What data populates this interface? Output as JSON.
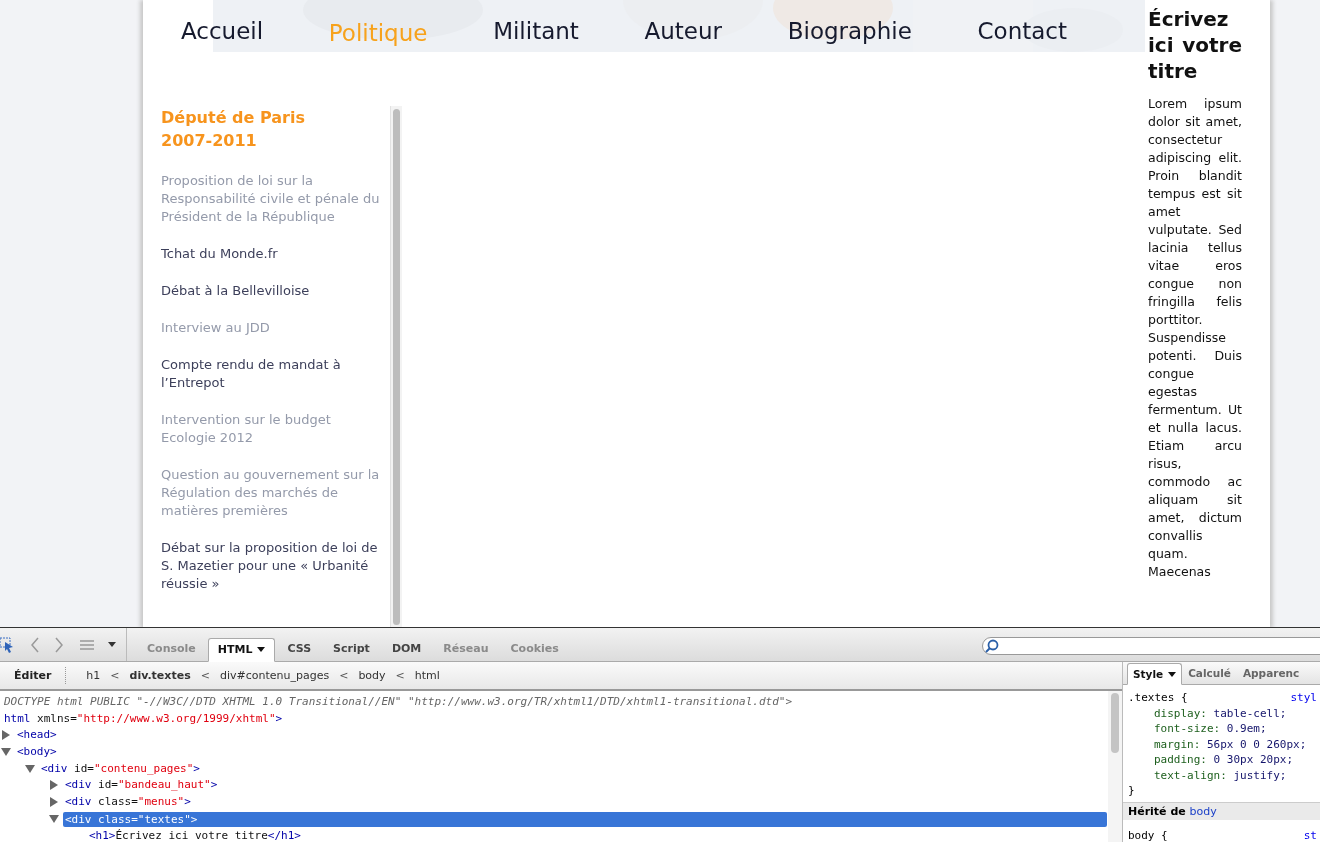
{
  "nav": [
    {
      "label": "Accueil",
      "selected": false
    },
    {
      "label": "Politique",
      "selected": true
    },
    {
      "label": "Militant",
      "selected": false
    },
    {
      "label": "Auteur",
      "selected": false
    },
    {
      "label": "Biographie",
      "selected": false
    },
    {
      "label": "Contact",
      "selected": false
    }
  ],
  "sidebar": {
    "title": "Député de Paris 2007-2011",
    "items": [
      {
        "label": "Proposition de loi sur la Responsabilité civile et pénale du Président de la République",
        "visited": true
      },
      {
        "label": "Tchat du Monde.fr",
        "visited": false
      },
      {
        "label": "Débat à la Bellevilloise",
        "visited": false
      },
      {
        "label": "Interview au JDD",
        "visited": true
      },
      {
        "label": "Compte rendu de mandat à l’Entrepot",
        "visited": false
      },
      {
        "label": "Intervention sur le budget Ecologie 2012",
        "visited": true
      },
      {
        "label": "Question au gouvernement sur la Régulation des marchés de matières premières",
        "visited": true
      },
      {
        "label": "Débat sur la proposition de loi de S. Mazetier pour une « Urbanité réussie »",
        "visited": false
      }
    ]
  },
  "article": {
    "title": "Écrivez ici votre titre",
    "body": "Lorem ipsum dolor sit amet, consectetur adipiscing elit. Proin blandit tempus est sit amet vulputate. Sed lacinia tellus vitae eros congue non fringilla felis porttitor. Suspendisse potenti. Duis congue egestas fermentum. Ut et nulla lacus. Etiam arcu risus, commodo ac aliquam sit amet, dictum convallis quam. Maecenas"
  },
  "devtools": {
    "tabs": [
      {
        "label": "Console",
        "selected": false,
        "disabled": true
      },
      {
        "label": "HTML",
        "selected": true,
        "disabled": false
      },
      {
        "label": "CSS",
        "selected": false,
        "disabled": false
      },
      {
        "label": "Script",
        "selected": false,
        "disabled": false
      },
      {
        "label": "DOM",
        "selected": false,
        "disabled": false
      },
      {
        "label": "Réseau",
        "selected": false,
        "disabled": true
      },
      {
        "label": "Cookies",
        "selected": false,
        "disabled": true
      }
    ],
    "breadcrumb": {
      "edit_button": "Éditer",
      "separator": "<",
      "items": [
        {
          "label": "h1",
          "selected": false
        },
        {
          "label": "div.textes",
          "selected": true
        },
        {
          "label": "div#contenu_pages",
          "selected": false
        },
        {
          "label": "body",
          "selected": false
        },
        {
          "label": "html",
          "selected": false
        }
      ]
    },
    "tree": [
      {
        "parts": [
          {
            "kind": "doctype",
            "text": "DOCTYPE html PUBLIC \"-//W3C//DTD XHTML 1.0 Transitional//EN\" \"http://www.w3.org/TR/xhtml1/DTD/xhtml1-transitional.dtd\">"
          }
        ]
      },
      {
        "parts": [
          {
            "kind": "tag",
            "text": "html"
          },
          {
            "kind": "attr",
            "text": " xmlns="
          },
          {
            "kind": "value",
            "text": "\"http://www.w3.org/1999/xhtml\""
          },
          {
            "kind": "tag",
            "text": ">"
          }
        ],
        "selected": false,
        "children": [
          {
            "parts": [
              {
                "kind": "tag",
                "text": "<head>"
              }
            ],
            "expanded": false,
            "selected": false
          },
          {
            "parts": [
              {
                "kind": "tag",
                "text": "<body>"
              }
            ],
            "expanded": true,
            "selected": false,
            "children": [
              {
                "parts": [
                  {
                    "kind": "tag",
                    "text": "<div"
                  },
                  {
                    "kind": "attr",
                    "text": " id="
                  },
                  {
                    "kind": "value",
                    "text": "\"contenu_pages\""
                  },
                  {
                    "kind": "tag",
                    "text": ">"
                  }
                ],
                "expanded": true,
                "selected": false,
                "children": [
                  {
                    "parts": [
                      {
                        "kind": "tag",
                        "text": "<div"
                      },
                      {
                        "kind": "attr",
                        "text": " id="
                      },
                      {
                        "kind": "value",
                        "text": "\"bandeau_haut\""
                      },
                      {
                        "kind": "tag",
                        "text": ">"
                      }
                    ],
                    "expanded": false,
                    "selected": false
                  },
                  {
                    "parts": [
                      {
                        "kind": "tag",
                        "text": "<div"
                      },
                      {
                        "kind": "attr",
                        "text": " class="
                      },
                      {
                        "kind": "value",
                        "text": "\"menus\""
                      },
                      {
                        "kind": "tag",
                        "text": ">"
                      }
                    ],
                    "expanded": false,
                    "selected": false
                  },
                  {
                    "parts": [
                      {
                        "kind": "tag",
                        "text": "<div"
                      },
                      {
                        "kind": "attr",
                        "text": " class="
                      },
                      {
                        "kind": "value",
                        "text": "\"textes\""
                      },
                      {
                        "kind": "tag",
                        "text": ">"
                      }
                    ],
                    "expanded": true,
                    "selected": true,
                    "children": [
                      {
                        "parts": [
                          {
                            "kind": "tag",
                            "text": "<h1>"
                          },
                          {
                            "kind": "text",
                            "text": "Écrivez ici votre titre"
                          },
                          {
                            "kind": "tag",
                            "text": "</h1>"
                          }
                        ],
                        "selected": false
                      }
                    ]
                  }
                ]
              }
            ]
          }
        ]
      }
    ],
    "side_tabs": [
      {
        "label": "Style",
        "selected": true
      },
      {
        "label": "Calculé",
        "selected": false
      },
      {
        "label": "Apparenc",
        "selected": false
      }
    ],
    "rules": [
      {
        "selector": ".textes {",
        "source": "styl",
        "declarations": [
          {
            "property": "display:",
            "value": "table-cell;"
          },
          {
            "property": "font-size:",
            "value": "0.9em;"
          },
          {
            "property": "margin:",
            "value": "56px 0 0 260px;"
          },
          {
            "property": "padding:",
            "value": "0 30px 20px;"
          },
          {
            "property": "text-align:",
            "value": "justify;"
          }
        ],
        "close": "}"
      }
    ],
    "inherited": {
      "label": "Hérité de",
      "from": "body"
    },
    "next_rule": {
      "selector": "body {",
      "source": "st"
    }
  }
}
